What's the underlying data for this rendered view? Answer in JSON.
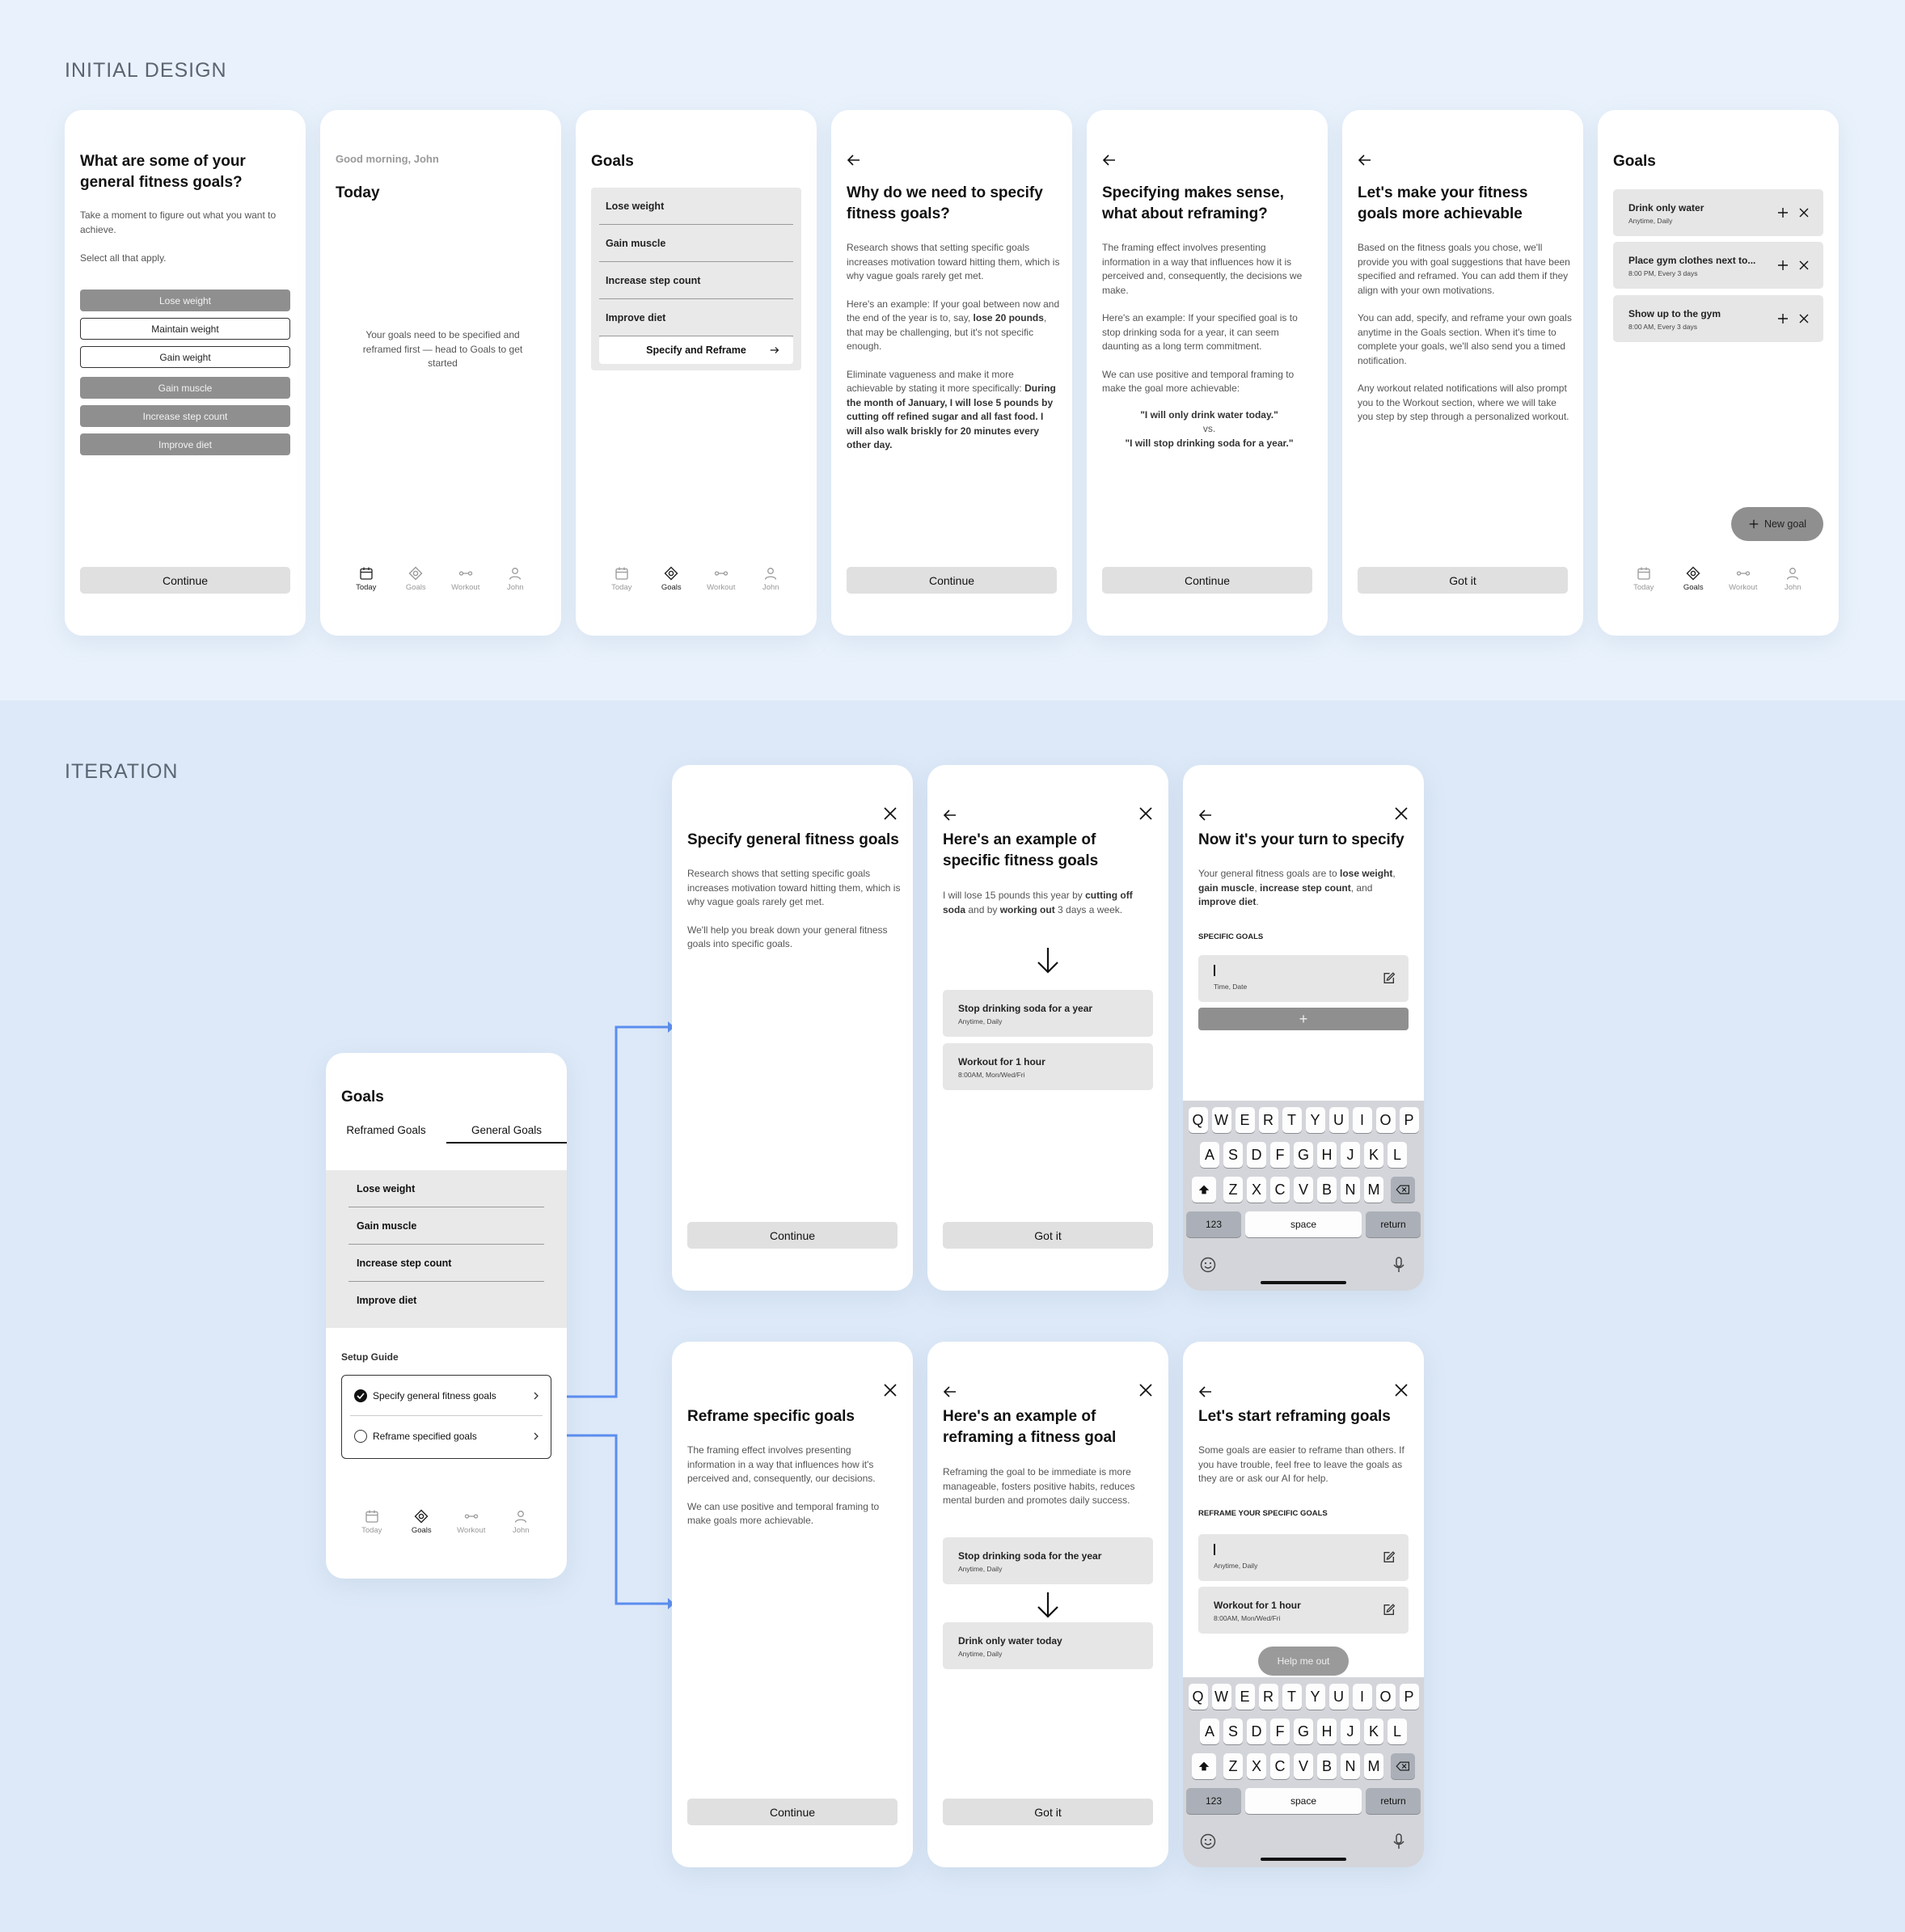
{
  "sections": {
    "initial": "INITIAL DESIGN",
    "iteration": "ITERATION"
  },
  "tabs": [
    "Today",
    "Goals",
    "Workout",
    "John"
  ],
  "keyboard": {
    "row1": [
      "Q",
      "W",
      "E",
      "R",
      "T",
      "Y",
      "U",
      "I",
      "O",
      "P"
    ],
    "row2": [
      "A",
      "S",
      "D",
      "F",
      "G",
      "H",
      "J",
      "K",
      "L"
    ],
    "row3": [
      "Z",
      "X",
      "C",
      "V",
      "B",
      "N",
      "M"
    ],
    "num": "123",
    "space": "space",
    "return": "return"
  },
  "s1": {
    "title": "What are some of your general fitness goals?",
    "desc": "Take a moment to figure out what you want to achieve.",
    "hint": "Select all that apply.",
    "options": [
      "Lose weight",
      "Maintain weight",
      "Gain weight",
      "Gain muscle",
      "Increase step count",
      "Improve diet"
    ],
    "button": "Continue"
  },
  "s2": {
    "greeting": "Good morning, John",
    "title": "Today",
    "empty": "Your goals need to be specified and reframed first — head to Goals to get started"
  },
  "s3": {
    "title": "Goals",
    "items": [
      "Lose weight",
      "Gain muscle",
      "Increase step count",
      "Improve diet"
    ],
    "action": "Specify and Reframe"
  },
  "s4": {
    "title": "Why do we need to specify fitness goals?",
    "p1": "Research shows that setting specific goals increases motivation toward hitting them, which is why vague goals rarely get met.",
    "p2a": "Here's an example: If your goal between now and the end of the year is to, say, ",
    "p2b": "lose 20 pounds",
    "p2c": ", that may be challenging, but it's not specific enough.",
    "p3a": "Eliminate vagueness and make it more achievable by stating it more specifically: ",
    "p3b": "During the month of January, I will lose 5 pounds by cutting off refined sugar and all fast food. I will also walk briskly for 20 minutes every other day.",
    "button": "Continue"
  },
  "s5": {
    "title": "Specifying makes sense, what about reframing?",
    "p1": "The framing effect involves presenting information in a way that influences how it is perceived and, consequently, the decisions we make.",
    "p2": "Here's an example: If your specified goal is to stop drinking soda for a year, it can seem daunting as a long term commitment.",
    "p3": "We can use positive and temporal framing to make the goal more achievable:",
    "q1": "\"I will only drink water today.\"",
    "vs": "vs.",
    "q2": "\"I will stop drinking soda for a year.\"",
    "button": "Continue"
  },
  "s6": {
    "title": "Let's make your fitness goals more achievable",
    "p1": "Based on the fitness goals you chose, we'll provide you with goal suggestions that have been specified and reframed. You can add them if they align with your own motivations.",
    "p2": "You can add, specify, and reframe your own goals anytime in the Goals section. When it's time to complete your goals, we'll also send you a timed notification.",
    "p3": "Any workout related notifications will also prompt you to the Workout section, where we will take you step by step through a personalized workout.",
    "button": "Got it"
  },
  "s7": {
    "title": "Goals",
    "cards": [
      {
        "title": "Drink only water",
        "sub": "Anytime, Daily"
      },
      {
        "title": "Place gym clothes next to...",
        "sub": "8:00 PM, Every 3 days"
      },
      {
        "title": "Show up to the gym",
        "sub": "8:00 AM, Every 3 days"
      }
    ],
    "new_goal": "New goal"
  },
  "hub": {
    "title": "Goals",
    "tab_a": "Reframed Goals",
    "tab_b": "General Goals",
    "items": [
      "Lose weight",
      "Gain muscle",
      "Increase step count",
      "Improve diet"
    ],
    "guide_label": "Setup Guide",
    "guide": [
      "Specify general fitness goals",
      "Reframe specified goals"
    ]
  },
  "i1": {
    "title": "Specify general fitness goals",
    "p1": "Research shows that setting specific goals increases motivation toward hitting them, which is why vague goals rarely get met.",
    "p2": "We'll help you break down your general fitness goals into specific goals.",
    "button": "Continue"
  },
  "i2": {
    "title": "Here's an example of specific fitness goals",
    "p_a": "I will lose 15 pounds this year by ",
    "p_b": "cutting off soda",
    "p_c": " and by ",
    "p_d": "working out",
    "p_e": " 3 days a week.",
    "cards": [
      {
        "title": "Stop drinking soda for a year",
        "sub": "Anytime, Daily"
      },
      {
        "title": "Workout for 1 hour",
        "sub": "8:00AM, Mon/Wed/Fri"
      }
    ],
    "button": "Got it"
  },
  "i3": {
    "title": "Now it's your turn to specify",
    "p_a": "Your general fitness goals are to ",
    "p_b": "lose weight",
    "p_c": ", ",
    "p_d": "gain muscle",
    "p_e": ", ",
    "p_f": "increase step count",
    "p_g": ", and ",
    "p_h": "improve diet",
    "p_i": ".",
    "label": "SPECIFIC GOALS",
    "field_hint": "Time, Date",
    "add": "+"
  },
  "i4": {
    "title": "Reframe specific goals",
    "p1": "The framing effect involves presenting information in a way that influences how it's perceived and, consequently, our decisions.",
    "p2": "We can use positive and temporal framing to make goals more achievable.",
    "button": "Continue"
  },
  "i5": {
    "title": "Here's an example of reframing a fitness goal",
    "p1": "Reframing the goal to be immediate is more manageable, fosters positive habits, reduces mental burden and promotes daily success.",
    "cards": [
      {
        "title": "Stop drinking soda for the year",
        "sub": "Anytime, Daily"
      },
      {
        "title": "Drink only water today",
        "sub": "Anytime, Daily"
      }
    ],
    "button": "Got it"
  },
  "i6": {
    "title": "Let's start reframing goals",
    "p1": "Some goals are easier to reframe than others. If you have trouble, feel free to leave the goals as they are or ask our AI for help.",
    "label": "REFRAME YOUR SPECIFIC GOALS",
    "fields": [
      {
        "title": "",
        "sub": "Anytime, Daily"
      },
      {
        "title": "Workout for 1 hour",
        "sub": "8:00AM, Mon/Wed/Fri"
      }
    ],
    "help": "Help me out"
  },
  "colors": {
    "connector": "#5b8def",
    "filled": "#8f8f8f",
    "card": "#e6e6e6"
  }
}
